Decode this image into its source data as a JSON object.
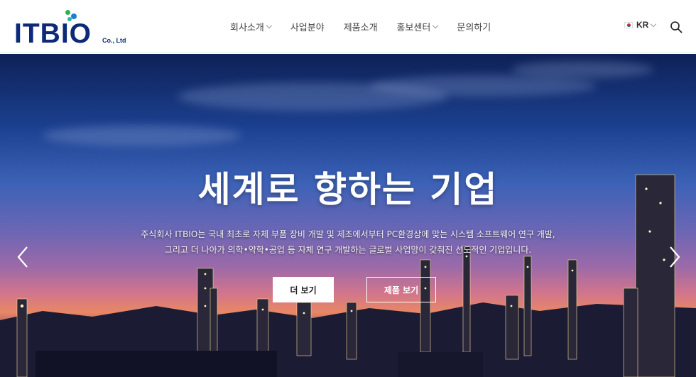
{
  "logo": {
    "main": "ITBIO",
    "sub": "Co., Ltd"
  },
  "nav": {
    "items": [
      {
        "label": "회사소개",
        "dropdown": true
      },
      {
        "label": "사업분야",
        "dropdown": false
      },
      {
        "label": "제품소개",
        "dropdown": false
      },
      {
        "label": "홍보센터",
        "dropdown": true
      },
      {
        "label": "문의하기",
        "dropdown": false
      }
    ]
  },
  "lang": {
    "label": "KR"
  },
  "hero": {
    "title": "세계로 향하는 기업",
    "desc_line1": "주식회사 ITBIO는 국내 최초로 자체 부품 장비 개발 및 제조에서부터 PC환경상에 맞는 시스템 소프트웨어 연구 개발,",
    "desc_line2": "그리고 더 나아가 의학•약학•공업 등 자체 연구 개발하는 글로벌 사업망이 갖춰진 선도적인 기업입니다.",
    "btn_more": "더 보기",
    "btn_products": "제품 보기"
  },
  "icons": {
    "search": "search-icon",
    "prev": "chevron-left-icon",
    "next": "chevron-right-icon"
  },
  "colors": {
    "brand": "#0d2a7a",
    "dot_green": "#2bb24c",
    "dot_blue": "#1f7bd6",
    "dot_teal": "#24b7b0"
  }
}
